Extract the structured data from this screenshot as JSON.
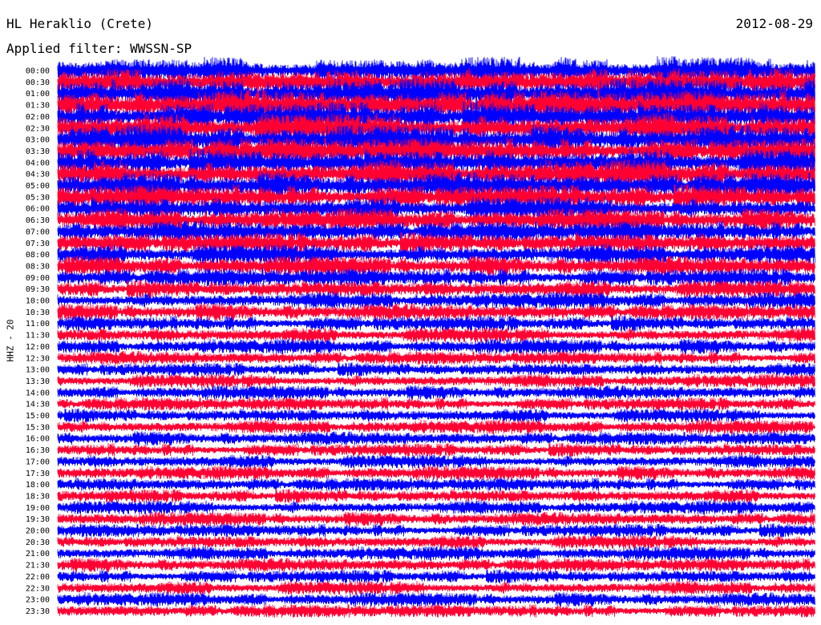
{
  "header": {
    "station": "HL Heraklio (Crete)",
    "date": "2012-08-29",
    "filter": "Applied filter: WWSSN-SP",
    "channel": "HHZ - 20"
  },
  "colors": {
    "trace_a": "#0000ff",
    "trace_b": "#ff0033",
    "background": "#ffffff"
  },
  "chart_data": {
    "type": "line",
    "title": "HL Heraklio (Crete)",
    "subtitle": "Applied filter: WWSSN-SP",
    "ylabel": "HHZ - 20",
    "xlabel": "",
    "row_labels": [
      "00:00",
      "00:30",
      "01:00",
      "01:30",
      "02:00",
      "02:30",
      "03:00",
      "03:30",
      "04:00",
      "04:30",
      "05:00",
      "05:30",
      "06:00",
      "06:30",
      "07:00",
      "07:30",
      "08:00",
      "08:30",
      "09:00",
      "09:30",
      "10:00",
      "10:30",
      "11:00",
      "11:30",
      "12:00",
      "12:30",
      "13:00",
      "13:30",
      "14:00",
      "14:30",
      "15:00",
      "15:30",
      "16:00",
      "16:30",
      "17:00",
      "17:30",
      "18:00",
      "18:30",
      "19:00",
      "19:30",
      "20:00",
      "20:30",
      "21:00",
      "21:30",
      "22:00",
      "22:30",
      "23:00",
      "23:30"
    ],
    "row_colors": "alternating blue / red",
    "relative_amplitude": [
      1.35,
      1.4,
      1.5,
      1.55,
      1.55,
      1.5,
      1.45,
      1.4,
      1.4,
      1.4,
      1.35,
      1.3,
      1.2,
      1.15,
      1.1,
      1.1,
      1.05,
      1.0,
      0.95,
      0.9,
      0.85,
      0.85,
      0.8,
      0.75,
      0.75,
      0.7,
      0.7,
      0.7,
      0.7,
      0.7,
      0.7,
      0.7,
      0.7,
      0.7,
      0.7,
      0.7,
      0.7,
      0.7,
      0.7,
      0.7,
      0.7,
      0.7,
      0.7,
      0.7,
      0.7,
      0.7,
      0.7,
      0.7
    ],
    "grid": false,
    "legend": "none"
  }
}
